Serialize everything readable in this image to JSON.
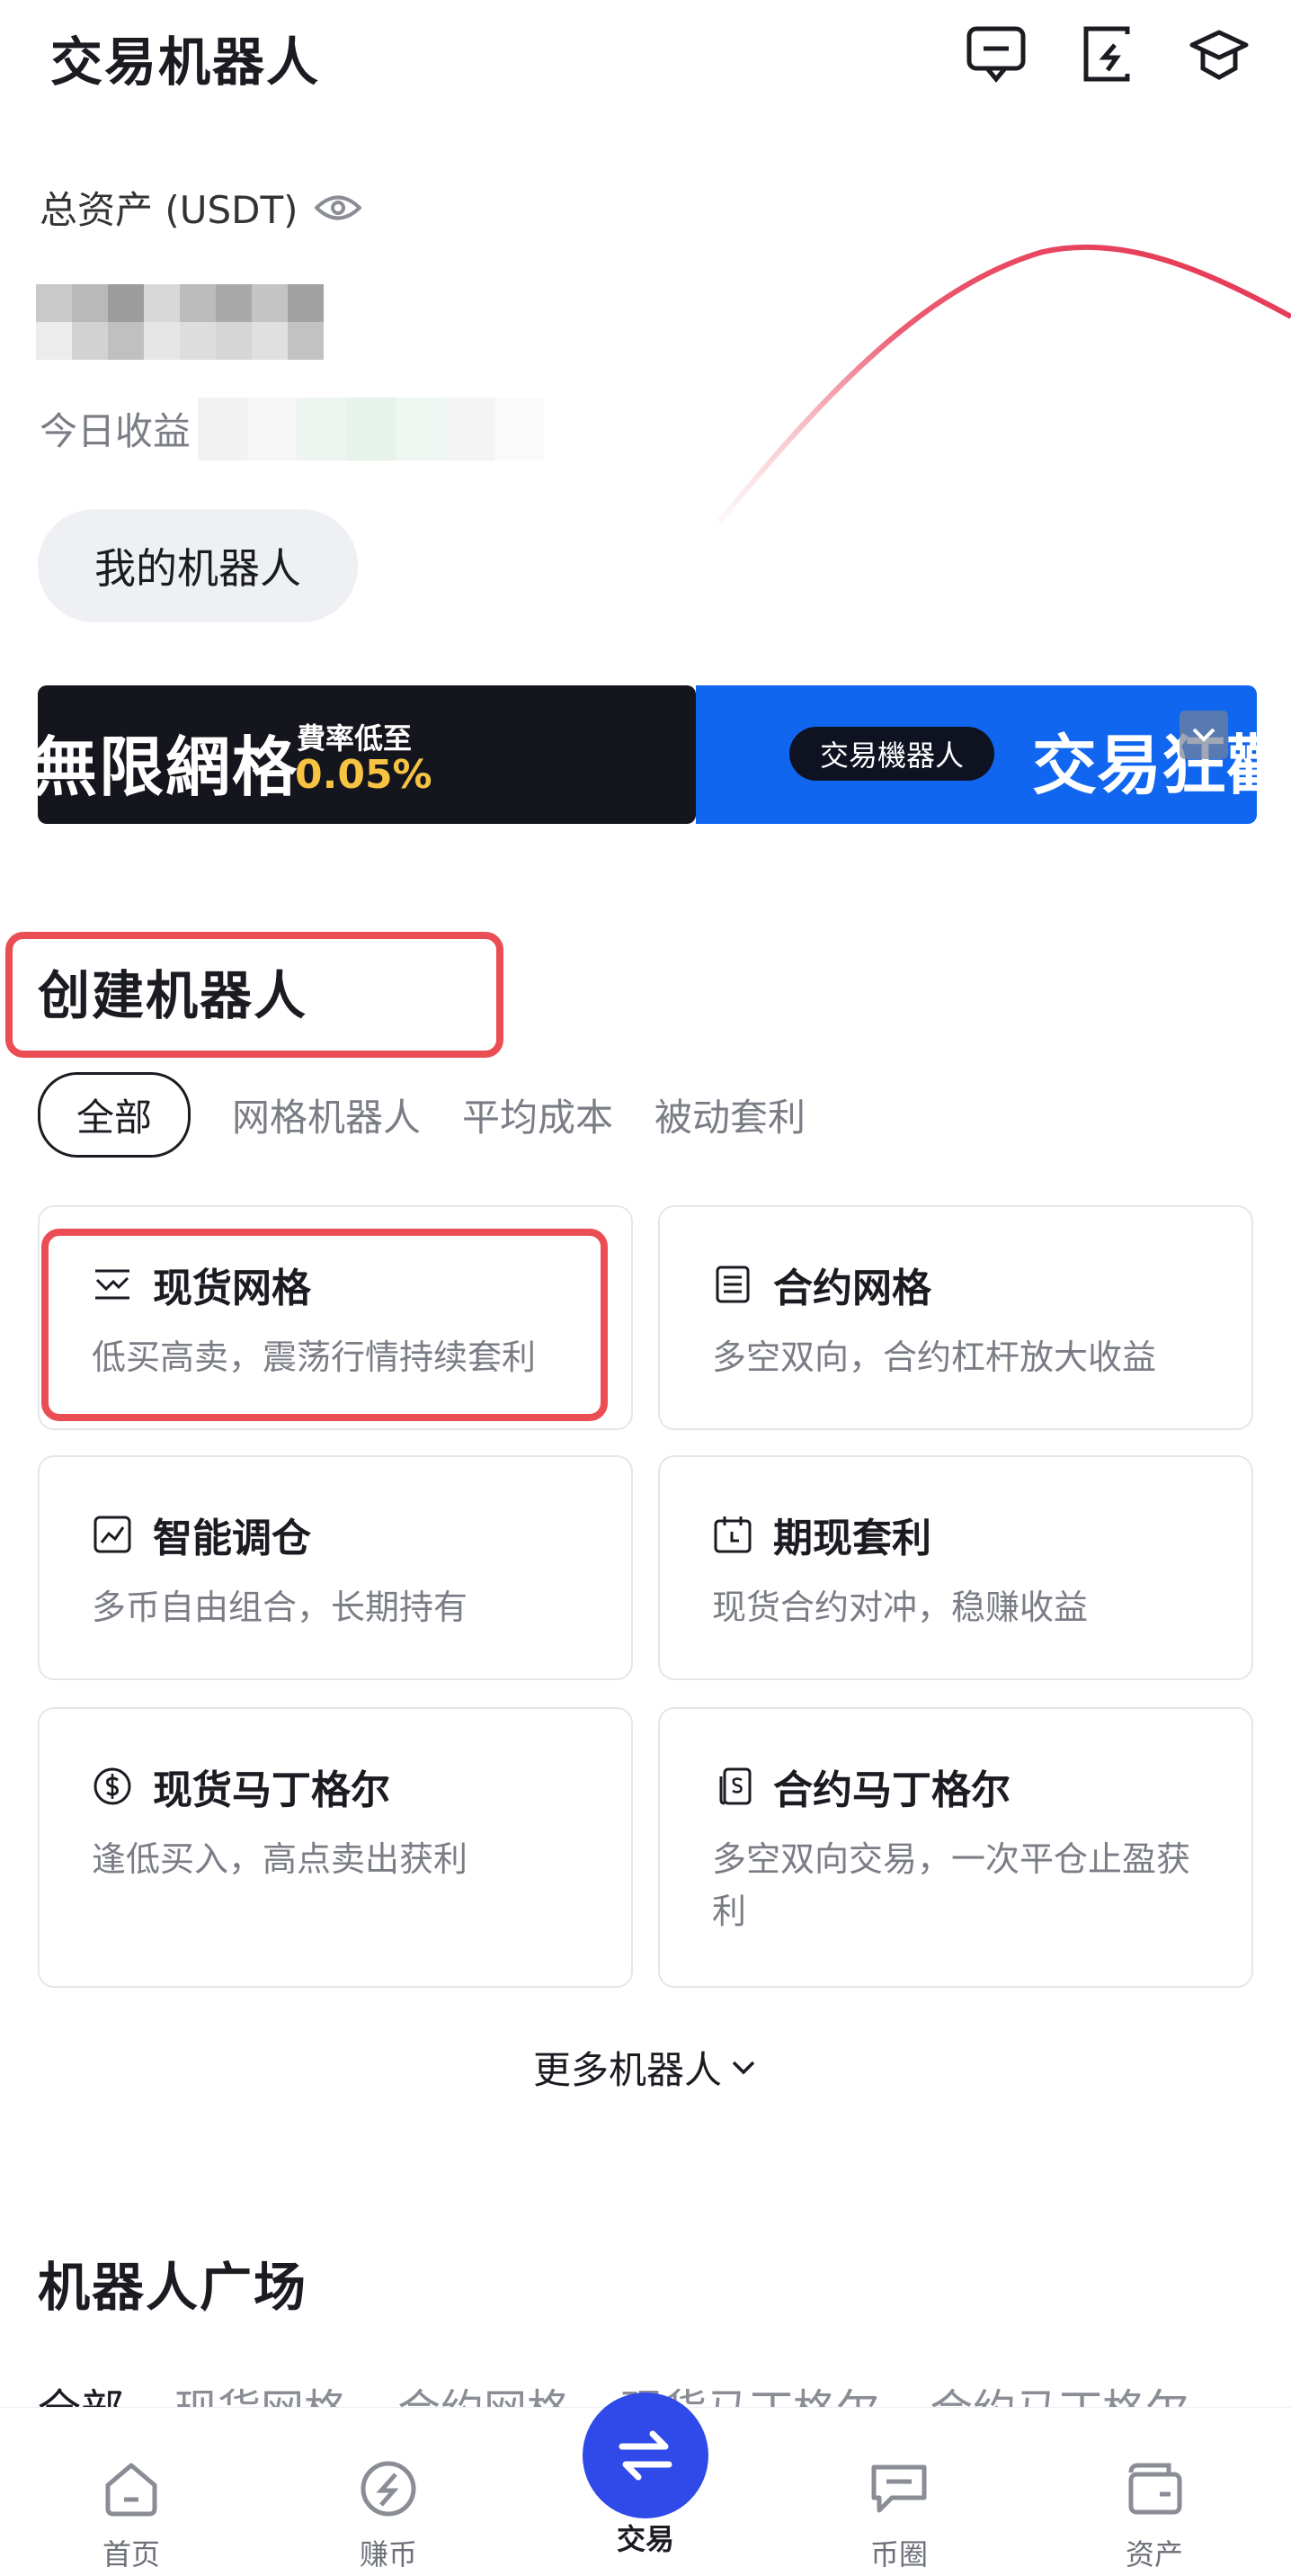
{
  "header": {
    "title": "交易机器人",
    "icons": [
      "message-icon",
      "share-icon",
      "academy-cap-icon"
    ]
  },
  "assets": {
    "label": "总资产 (USDT)",
    "today_label": "今日收益"
  },
  "my_bots_button": "我的机器人",
  "banners": [
    {
      "big": "無限網格",
      "small": "費率低至",
      "rate": "0.05%"
    },
    {
      "pill": "交易機器人",
      "big": "交易狂歡"
    }
  ],
  "create": {
    "title": "创建机器人"
  },
  "tabs": [
    "全部",
    "网格机器人",
    "平均成本",
    "被动套利"
  ],
  "cards": [
    {
      "title": "现货网格",
      "desc": "低买高卖，震荡行情持续套利",
      "icon": "spot-grid-icon"
    },
    {
      "title": "合约网格",
      "desc": "多空双向，合约杠杆放大收益",
      "icon": "futures-grid-icon"
    },
    {
      "title": "智能调仓",
      "desc": "多币自由组合，长期持有",
      "icon": "rebalance-icon"
    },
    {
      "title": "期现套利",
      "desc": "现货合约对冲，稳赚收益",
      "icon": "calendar-icon"
    },
    {
      "title": "现货马丁格尔",
      "desc": "逢低买入，高点卖出获利",
      "icon": "dollar-circle-icon"
    },
    {
      "title": "合约马丁格尔",
      "desc": "多空双向交易，一次平仓止盈获利",
      "icon": "futures-dollar-icon"
    }
  ],
  "more": "更多机器人",
  "plaza": {
    "title": "机器人广场",
    "tabs": [
      "全部",
      "现货网格",
      "合约网格",
      "现货马丁格尔",
      "合约马丁格尔"
    ]
  },
  "nav": [
    "首页",
    "赚币",
    "交易",
    "币圈",
    "资产"
  ],
  "colors": {
    "accent": "#2f4ae8",
    "highlight": "#ea4d53",
    "banner_blue": "#1166f0",
    "rate_yellow": "#f6c343"
  }
}
